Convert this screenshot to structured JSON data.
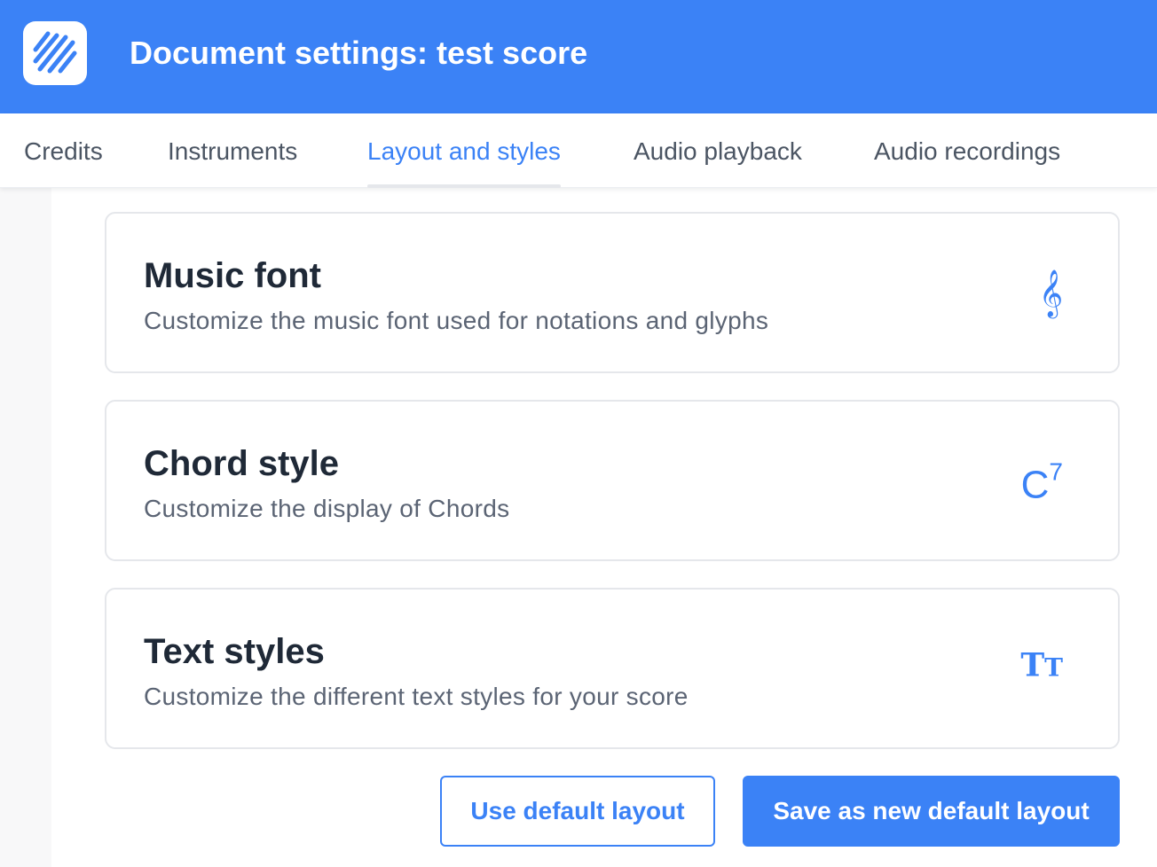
{
  "header": {
    "title": "Document settings: test score",
    "brand_color": "#3b82f6",
    "logo_icon": "stripes-logo-icon"
  },
  "tabs": [
    {
      "label": "Credits",
      "active": false
    },
    {
      "label": "Instruments",
      "active": false
    },
    {
      "label": "Layout and styles",
      "active": true
    },
    {
      "label": "Audio playback",
      "active": false
    },
    {
      "label": "Audio recordings",
      "active": false
    }
  ],
  "cards": [
    {
      "title": "Music font",
      "description": "Customize the music font used for notations and glyphs",
      "icon": "treble-clef-icon",
      "icon_glyph": "𝄞"
    },
    {
      "title": "Chord style",
      "description": "Customize the display of Chords",
      "icon": "chord-c7-icon",
      "icon_base": "C",
      "icon_sup": "7"
    },
    {
      "title": "Text styles",
      "description": "Customize the different text styles for your score",
      "icon": "text-size-icon",
      "icon_big": "T",
      "icon_small": "T"
    }
  ],
  "actions": {
    "use_default": "Use default layout",
    "save_default": "Save as new default layout"
  },
  "colors": {
    "accent": "#3b82f6",
    "title_text": "#1f2937",
    "muted_text": "#5b6474",
    "border": "#e5e7eb"
  }
}
